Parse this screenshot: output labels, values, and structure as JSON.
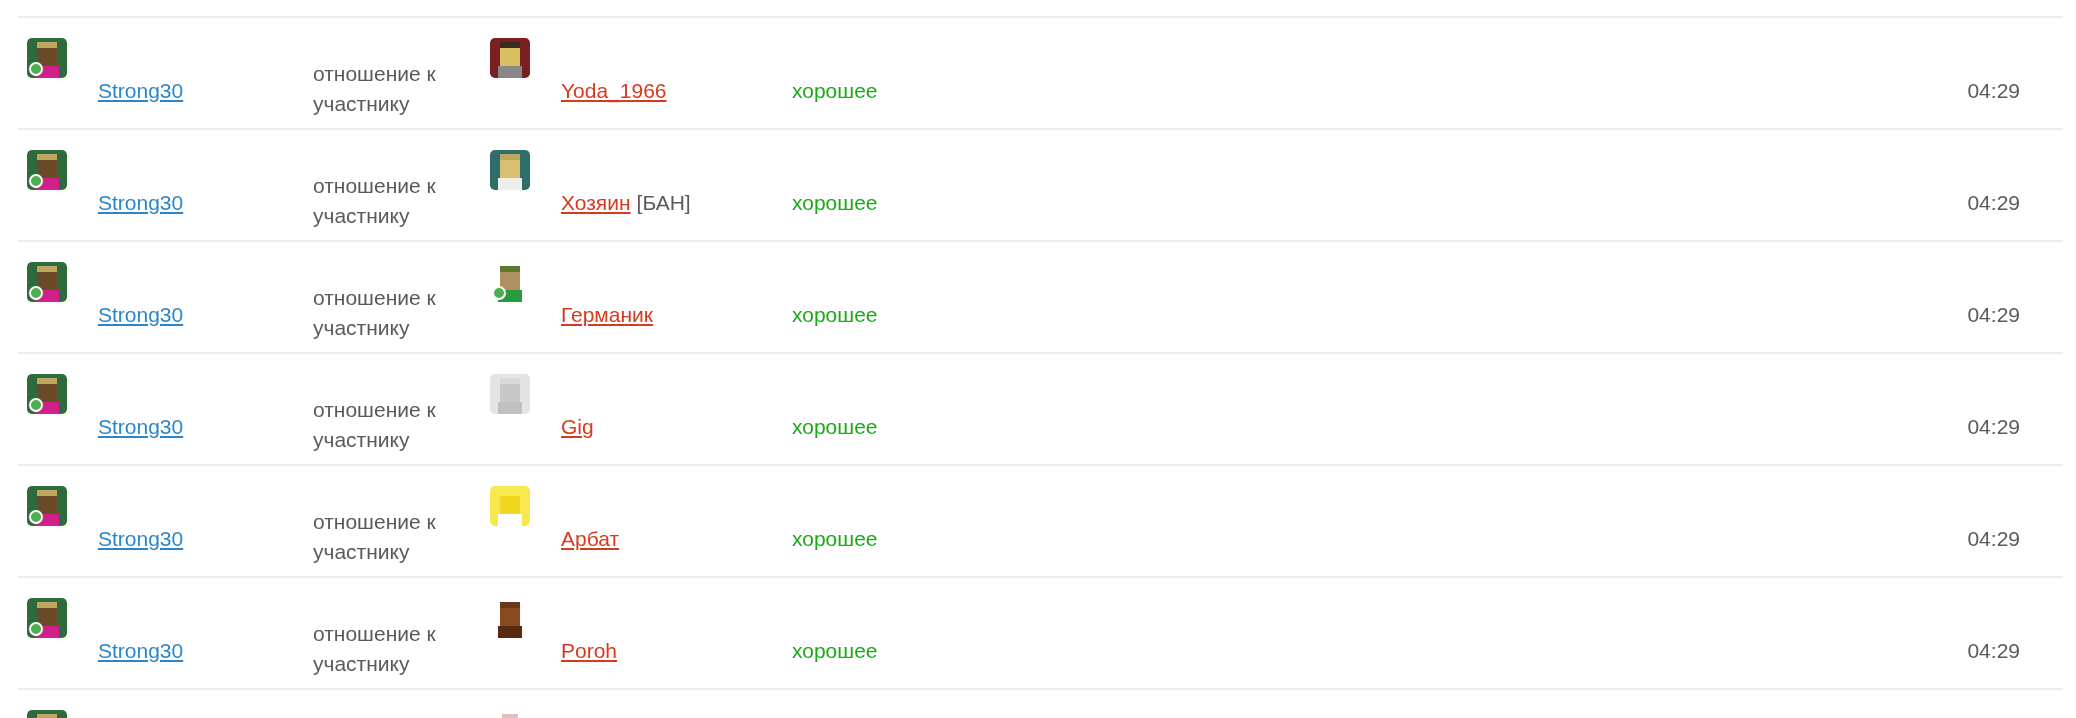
{
  "rows": [
    {
      "kind": "full",
      "author": {
        "name": "Strong30",
        "online": true
      },
      "action": "отношение к участнику",
      "target": {
        "name": "Yoda_1966",
        "online": false
      },
      "rating": "хорошее",
      "time": "04:29"
    },
    {
      "kind": "full",
      "author": {
        "name": "Strong30",
        "online": true
      },
      "action": "отношение к участнику",
      "target": {
        "name": "Хозяин",
        "online": false,
        "tag": "[БАН]"
      },
      "rating": "хорошее",
      "time": "04:29"
    },
    {
      "kind": "full",
      "author": {
        "name": "Strong30",
        "online": true
      },
      "action": "отношение к участнику",
      "target": {
        "name": "Германик",
        "online": true
      },
      "rating": "хорошее",
      "time": "04:29"
    },
    {
      "kind": "full",
      "author": {
        "name": "Strong30",
        "online": true
      },
      "action": "отношение к участнику",
      "target": {
        "name": "Gig",
        "online": false
      },
      "rating": "хорошее",
      "time": "04:29"
    },
    {
      "kind": "full",
      "author": {
        "name": "Strong30",
        "online": true
      },
      "action": "отношение к участнику",
      "target": {
        "name": "Арбат",
        "online": false
      },
      "rating": "хорошее",
      "time": "04:29"
    },
    {
      "kind": "full",
      "author": {
        "name": "Strong30",
        "online": true
      },
      "action": "отношение к участнику",
      "target": {
        "name": "Poroh",
        "online": false
      },
      "rating": "хорошее",
      "time": "04:29"
    },
    {
      "kind": "partial"
    }
  ]
}
